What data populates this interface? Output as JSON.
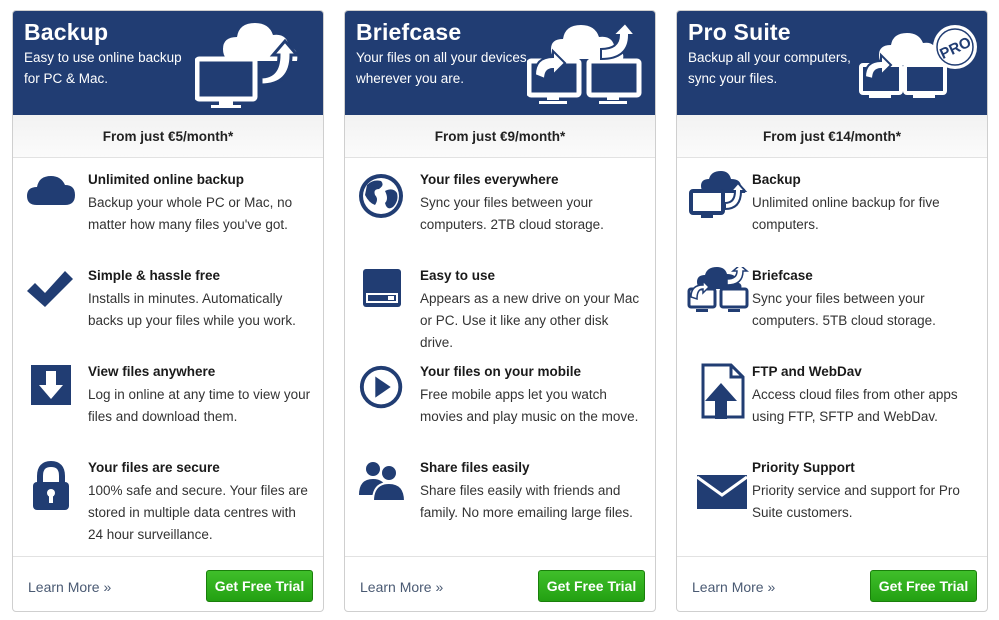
{
  "brand_color": "#213d73",
  "button_color": "#2fae1c",
  "cards": [
    {
      "title": "Backup",
      "tagline": "Easy to use online backup for PC & Mac.",
      "price": "From just €5/month*",
      "features": [
        {
          "icon": "cloud-icon",
          "title": "Unlimited online backup",
          "desc": "Backup your whole PC or Mac, no matter how many files you've got."
        },
        {
          "icon": "checkmark-icon",
          "title": "Simple & hassle free",
          "desc": "Installs in minutes. Automatically backs up your files while you work."
        },
        {
          "icon": "download-arrow-icon",
          "title": "View files anywhere",
          "desc": "Log in online at any time to view your files and download them."
        },
        {
          "icon": "padlock-icon",
          "title": "Your files are secure",
          "desc": "100% safe and secure. Your files are stored in multiple data centres with 24 hour surveillance."
        }
      ],
      "learn_more": "Learn More »",
      "cta": "Get Free Trial"
    },
    {
      "title": "Briefcase",
      "tagline": "Your files on all your devices, wherever you are.",
      "price": "From just €9/month*",
      "features": [
        {
          "icon": "globe-icon",
          "title": "Your files everywhere",
          "desc": "Sync your files between your computers. 2TB cloud storage."
        },
        {
          "icon": "hard-drive-icon",
          "title": "Easy to use",
          "desc": "Appears as a new drive on your Mac or PC. Use it like any other disk drive."
        },
        {
          "icon": "play-icon",
          "title": "Your files on your mobile",
          "desc": "Free mobile apps let you watch movies and play music on the move."
        },
        {
          "icon": "users-icon",
          "title": "Share files easily",
          "desc": "Share files easily with friends and family. No more emailing large files."
        }
      ],
      "learn_more": "Learn More »",
      "cta": "Get Free Trial"
    },
    {
      "title": "Pro Suite",
      "tagline": "Backup all your computers, sync your files.",
      "price": "From just €14/month*",
      "badge": "PRO",
      "features": [
        {
          "icon": "backup-icon",
          "title": "Backup",
          "desc": "Unlimited online backup for five computers."
        },
        {
          "icon": "briefcase-sync-icon",
          "title": "Briefcase",
          "desc": "Sync your files between your computers. 5TB cloud storage."
        },
        {
          "icon": "file-upload-icon",
          "title": "FTP and WebDav",
          "desc": "Access cloud files from other apps using FTP, SFTP and WebDav."
        },
        {
          "icon": "envelope-icon",
          "title": "Priority Support",
          "desc": "Priority service and support for Pro Suite customers."
        }
      ],
      "learn_more": "Learn More »",
      "cta": "Get Free Trial"
    }
  ]
}
